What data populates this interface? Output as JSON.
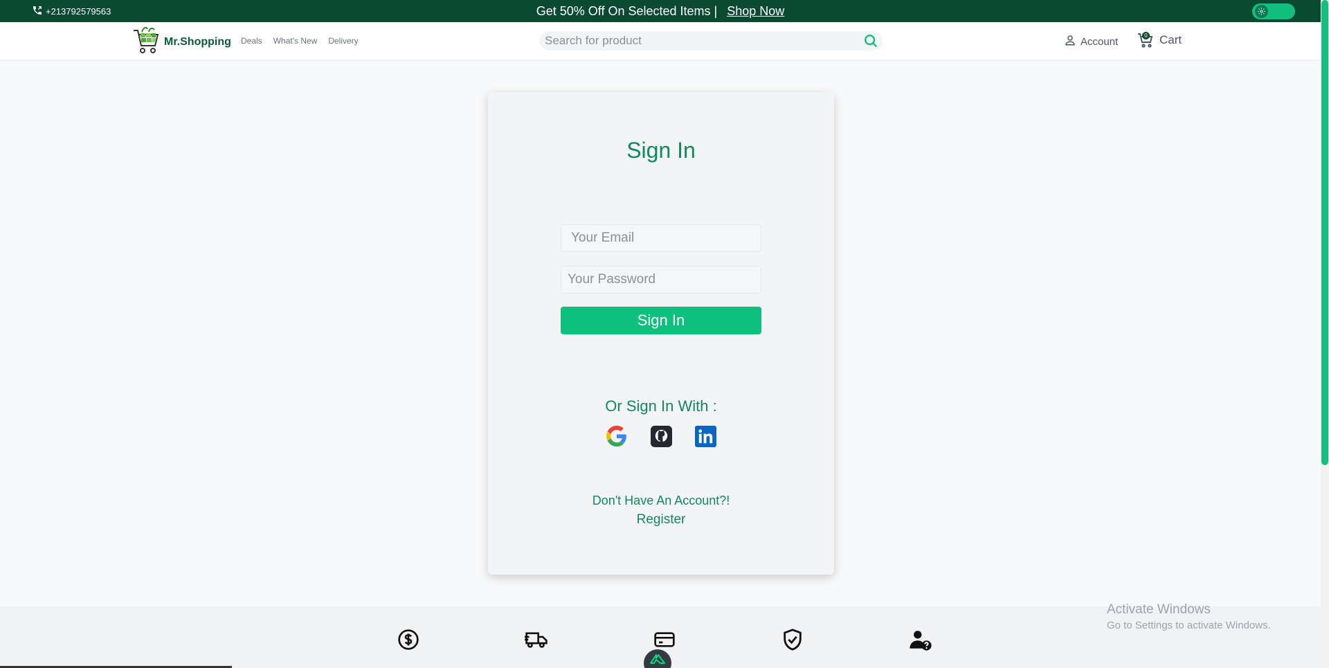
{
  "topbar": {
    "phone": "+213792579563",
    "promo_text": "Get 50% Off On Selected Items |",
    "promo_link": "Shop Now"
  },
  "header": {
    "logo_text": "Mr.Shopping",
    "nav": [
      "Deals",
      "What's New",
      "Delivery"
    ],
    "search_placeholder": "Search for product",
    "account_label": "Account",
    "cart_label": "Cart",
    "cart_count": "0"
  },
  "signin": {
    "title": "Sign In",
    "email_placeholder": "Your Email",
    "password_placeholder": "Your Password",
    "submit_label": "Sign In",
    "or_text": "Or Sign In With :",
    "socials": [
      "google-icon",
      "github-icon",
      "linkedin-icon"
    ],
    "no_account_text": "Don't Have An Account?!",
    "register_label": "Register"
  },
  "footer": {
    "icons": [
      "dollar-icon",
      "truck-icon",
      "credit-card-icon",
      "shield-check-icon",
      "user-help-icon"
    ]
  },
  "watermark": {
    "line1": "Activate Windows",
    "line2": "Go to Settings to activate Windows."
  },
  "colors": {
    "brand_dark": "#0a4a33",
    "accent": "#0dc07e",
    "text_green": "#0e8a5c"
  }
}
